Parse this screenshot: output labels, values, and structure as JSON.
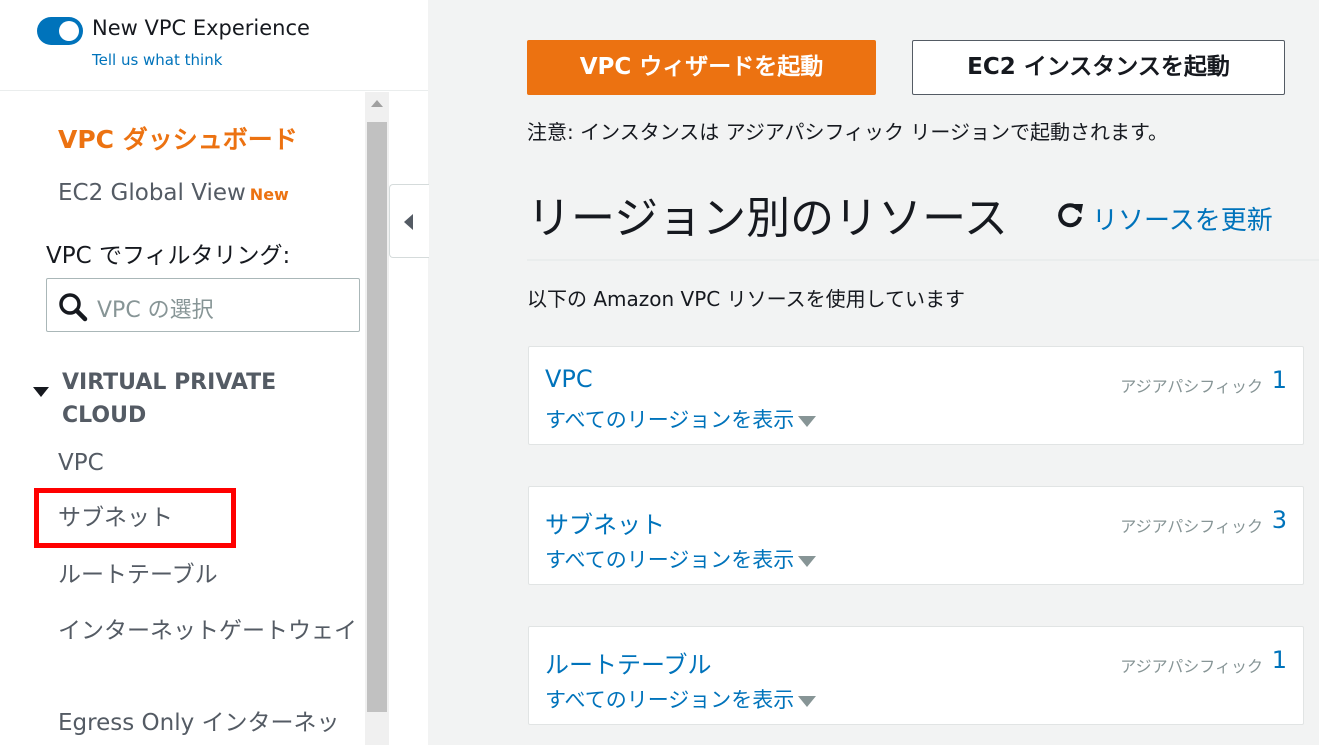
{
  "new_vpc_experience": {
    "title": "New VPC Experience",
    "feedback_link": "Tell us what think",
    "toggle_on": true
  },
  "sidebar": {
    "dashboard": "VPC ダッシュボード",
    "ec2_global_view": "EC2 Global View",
    "new_badge": "New",
    "filter_label": "VPC でフィルタリング:",
    "vpc_select_placeholder": "VPC の選択",
    "section_title": "VIRTUAL PRIVATE CLOUD",
    "items": [
      {
        "label": "VPC"
      },
      {
        "label": "サブネット"
      },
      {
        "label": "ルートテーブル"
      },
      {
        "label": "インターネットゲートウェイ"
      },
      {
        "label": "Egress Only インターネッ"
      }
    ],
    "highlighted_item_index": 1
  },
  "main": {
    "wizard_button": "VPC ウィザードを起動",
    "ec2_button": "EC2 インスタンスを起動",
    "note": "注意: インスタンスは アジアパシフィック リージョンで起動されます。",
    "heading": "リージョン別のリソース",
    "refresh_label": "リソースを更新",
    "using_text": "以下の Amazon VPC リソースを使用しています",
    "cards": [
      {
        "title": "VPC",
        "link": "すべてのリージョンを表示",
        "region": "アジアパシフィック",
        "count": "1"
      },
      {
        "title": "サブネット",
        "link": "すべてのリージョンを表示",
        "region": "アジアパシフィック",
        "count": "3"
      },
      {
        "title": "ルートテーブル",
        "link": "すべてのリージョンを表示",
        "region": "アジアパシフィック",
        "count": "1"
      }
    ]
  },
  "colors": {
    "accent_orange": "#ec7211",
    "link_blue": "#0073bb",
    "highlight_red": "#ff0000"
  },
  "icons": {
    "toggle": "toggle-switch-icon",
    "search": "search-icon",
    "refresh": "refresh-icon",
    "collapse": "collapse-left-icon",
    "dropdown": "caret-down-icon"
  }
}
